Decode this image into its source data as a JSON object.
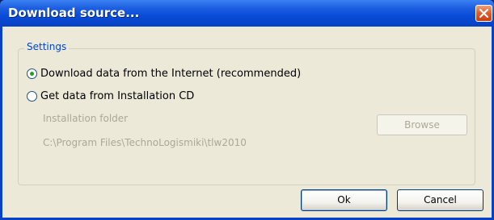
{
  "window": {
    "title": "Download source..."
  },
  "settings": {
    "group_label": "Settings",
    "options": [
      {
        "label": "Download data from the Internet (recommended)",
        "checked": true
      },
      {
        "label": "Get data from Installation CD",
        "checked": false
      }
    ],
    "folder_label": "Installation folder",
    "folder_path": "C:\\Program Files\\TechnoLogismiki\\tlw2010",
    "browse_label": "Browse"
  },
  "buttons": {
    "ok": "Ok",
    "cancel": "Cancel"
  },
  "colors": {
    "title_bar": "#0a4bd8",
    "accent_label": "#0046d5",
    "radio_check": "#21a121",
    "disabled_text": "#aca899"
  }
}
